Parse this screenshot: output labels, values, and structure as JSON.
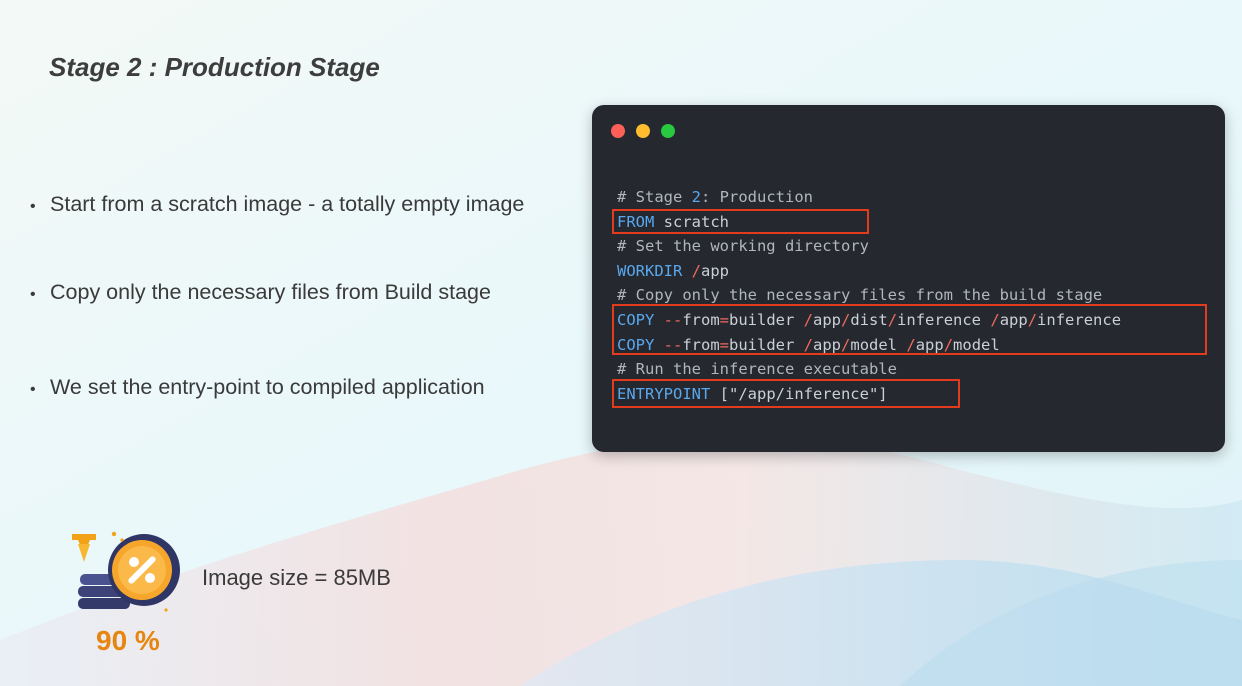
{
  "slide": {
    "title": "Stage 2 : Production Stage",
    "bullets": [
      "Start from a scratch image - a totally empty image",
      "Copy only the necessary files from Build stage",
      "We set the entry-point to compiled application"
    ],
    "bullet_glyph": "•"
  },
  "code": {
    "lines": [
      [
        {
          "t": "# Stage ",
          "c": "comment"
        },
        {
          "t": "2",
          "c": "num"
        },
        {
          "t": ": Production",
          "c": "comment"
        }
      ],
      [
        {
          "t": "FROM",
          "c": "kw"
        },
        {
          "t": " scratch",
          "c": "text"
        }
      ],
      [
        {
          "t": "# Set the working directory",
          "c": "comment"
        }
      ],
      [
        {
          "t": "WORKDIR",
          "c": "kw"
        },
        {
          "t": " ",
          "c": "text"
        },
        {
          "t": "/",
          "c": "op"
        },
        {
          "t": "app",
          "c": "text"
        }
      ],
      [
        {
          "t": "# Copy only the necessary files from the build stage",
          "c": "comment"
        }
      ],
      [
        {
          "t": "COPY",
          "c": "kw"
        },
        {
          "t": " ",
          "c": "text"
        },
        {
          "t": "--",
          "c": "op"
        },
        {
          "t": "from",
          "c": "text"
        },
        {
          "t": "=",
          "c": "op"
        },
        {
          "t": "builder ",
          "c": "text"
        },
        {
          "t": "/",
          "c": "op"
        },
        {
          "t": "app",
          "c": "text"
        },
        {
          "t": "/",
          "c": "op"
        },
        {
          "t": "dist",
          "c": "text"
        },
        {
          "t": "/",
          "c": "op"
        },
        {
          "t": "inference ",
          "c": "text"
        },
        {
          "t": "/",
          "c": "op"
        },
        {
          "t": "app",
          "c": "text"
        },
        {
          "t": "/",
          "c": "op"
        },
        {
          "t": "inference",
          "c": "text"
        }
      ],
      [
        {
          "t": "COPY",
          "c": "kw"
        },
        {
          "t": " ",
          "c": "text"
        },
        {
          "t": "--",
          "c": "op"
        },
        {
          "t": "from",
          "c": "text"
        },
        {
          "t": "=",
          "c": "op"
        },
        {
          "t": "builder ",
          "c": "text"
        },
        {
          "t": "/",
          "c": "op"
        },
        {
          "t": "app",
          "c": "text"
        },
        {
          "t": "/",
          "c": "op"
        },
        {
          "t": "model ",
          "c": "text"
        },
        {
          "t": "/",
          "c": "op"
        },
        {
          "t": "app",
          "c": "text"
        },
        {
          "t": "/",
          "c": "op"
        },
        {
          "t": "model",
          "c": "text"
        }
      ],
      [
        {
          "t": "# Run the inference executable",
          "c": "comment"
        }
      ],
      [
        {
          "t": "ENTRYPOINT",
          "c": "kw"
        },
        {
          "t": " [\"/app/inference\"]",
          "c": "text"
        }
      ]
    ]
  },
  "stats": {
    "percent": "90 %",
    "image_size": "Image size = 85MB",
    "badge_icon": "percent-coin-icon"
  },
  "colors": {
    "highlight_border": "#e23b1e",
    "code_bg": "#25282e",
    "percent_text": "#e8850e",
    "keyword": "#59a8ee"
  }
}
